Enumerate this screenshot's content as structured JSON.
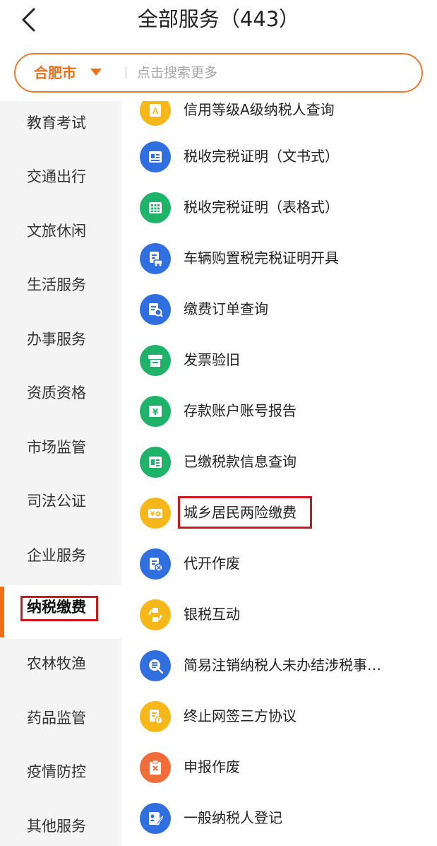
{
  "header": {
    "title": "全部服务（443）"
  },
  "search": {
    "city": "合肥市",
    "placeholder": "点击搜索更多"
  },
  "sidebar": {
    "items": [
      {
        "label": "教育考试",
        "active": false
      },
      {
        "label": "交通出行",
        "active": false
      },
      {
        "label": "文旅休闲",
        "active": false
      },
      {
        "label": "生活服务",
        "active": false
      },
      {
        "label": "办事服务",
        "active": false
      },
      {
        "label": "资质资格",
        "active": false
      },
      {
        "label": "市场监管",
        "active": false
      },
      {
        "label": "司法公证",
        "active": false
      },
      {
        "label": "企业服务",
        "active": false
      },
      {
        "label": "纳税缴费",
        "active": true
      },
      {
        "label": "农林牧渔",
        "active": false
      },
      {
        "label": "药品监管",
        "active": false
      },
      {
        "label": "疫情防控",
        "active": false
      },
      {
        "label": "其他服务",
        "active": false
      }
    ]
  },
  "services": [
    {
      "label": "信用等级A级纳税人查询",
      "icon": "credit-rating-icon",
      "color": "#f5b818"
    },
    {
      "label": "税收完税证明（文书式）",
      "icon": "document-certificate-icon",
      "color": "#2f6fe0"
    },
    {
      "label": "税收完税证明（表格式）",
      "icon": "table-certificate-icon",
      "color": "#1fb36a"
    },
    {
      "label": "车辆购置税完税证明开具",
      "icon": "vehicle-tax-icon",
      "color": "#2f6fe0"
    },
    {
      "label": "缴费订单查询",
      "icon": "order-search-icon",
      "color": "#2f6fe0"
    },
    {
      "label": "发票验旧",
      "icon": "invoice-icon",
      "color": "#1fb36a"
    },
    {
      "label": "存款账户账号报告",
      "icon": "yuan-account-icon",
      "color": "#1fb36a"
    },
    {
      "label": "已缴税款信息查询",
      "icon": "tax-info-icon",
      "color": "#1fb36a"
    },
    {
      "label": "城乡居民两险缴费",
      "icon": "wallet-icon",
      "color": "#f5b818"
    },
    {
      "label": "代开作废",
      "icon": "void-document-icon",
      "color": "#2f6fe0"
    },
    {
      "label": "银税互动",
      "icon": "exchange-icon",
      "color": "#f5b818"
    },
    {
      "label": "简易注销纳税人未办结涉税事…",
      "icon": "magnifier-list-icon",
      "color": "#2f6fe0"
    },
    {
      "label": "终止网签三方协议",
      "icon": "agreement-stop-icon",
      "color": "#f5b818"
    },
    {
      "label": "申报作废",
      "icon": "clipboard-void-icon",
      "color": "#f26d3a"
    },
    {
      "label": "一般纳税人登记",
      "icon": "registration-icon",
      "color": "#2f6fe0"
    }
  ],
  "colors": {
    "accent": "#f26d14",
    "highlight_box": "#d0161f",
    "sidebar_bg": "#f4f4f4"
  }
}
